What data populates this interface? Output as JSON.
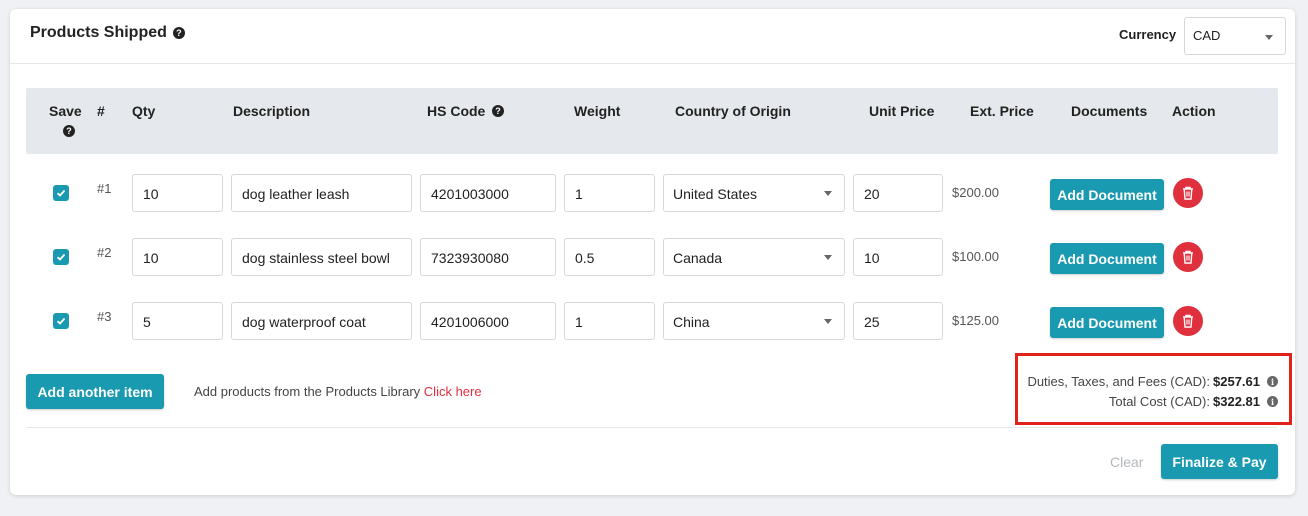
{
  "header": {
    "title": "Products Shipped",
    "title_help_icon": "question-circle-icon",
    "currency_label": "Currency",
    "currency_value": "CAD"
  },
  "table": {
    "columns": {
      "save": "Save",
      "num": "#",
      "qty": "Qty",
      "description": "Description",
      "hs_code": "HS Code",
      "weight": "Weight",
      "country": "Country of Origin",
      "unit_price": "Unit Price",
      "ext_price": "Ext. Price",
      "documents": "Documents",
      "action": "Action"
    },
    "rows": [
      {
        "saved": true,
        "num": "#1",
        "qty": "10",
        "description": "dog leather leash",
        "hs_code": "4201003000",
        "weight": "1",
        "country": "United States",
        "unit_price": "20",
        "ext_price": "$200.00",
        "doc_button": "Add Document"
      },
      {
        "saved": true,
        "num": "#2",
        "qty": "10",
        "description": "dog stainless steel bowl",
        "hs_code": "7323930080",
        "weight": "0.5",
        "country": "Canada",
        "unit_price": "10",
        "ext_price": "$100.00",
        "doc_button": "Add Document"
      },
      {
        "saved": true,
        "num": "#3",
        "qty": "5",
        "description": "dog waterproof coat",
        "hs_code": "4201006000",
        "weight": "1",
        "country": "China",
        "unit_price": "25",
        "ext_price": "$125.00",
        "doc_button": "Add Document"
      }
    ]
  },
  "footer": {
    "add_item_button": "Add another item",
    "library_text": "Add products from the Products Library",
    "library_link": "Click here",
    "duties_label": "Duties, Taxes, and Fees (CAD):",
    "duties_value": "$257.61",
    "total_label": "Total Cost (CAD):",
    "total_value": "$322.81",
    "clear_button": "Clear",
    "finalize_button": "Finalize & Pay"
  },
  "colors": {
    "accent": "#1a9ab0",
    "danger": "#e0303e",
    "highlight_border": "#e0221b"
  }
}
